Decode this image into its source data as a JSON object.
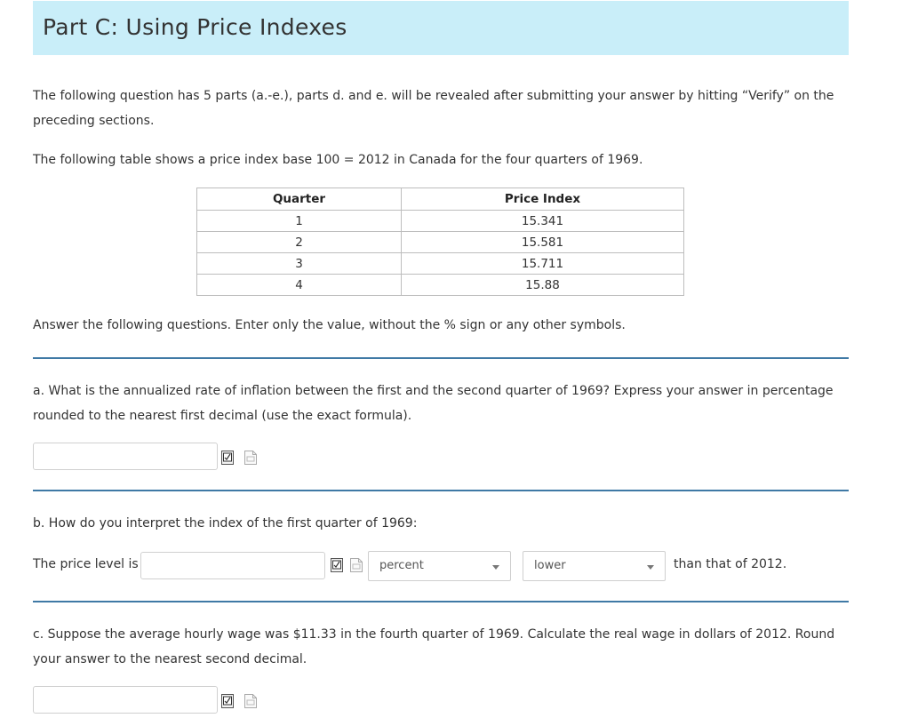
{
  "header": {
    "title": "Part C: Using Price Indexes"
  },
  "intro": {
    "line1": "The following question has 5 parts (a.-e.), parts d. and e. will be revealed after submitting your answer by hitting “Verify” on the preceding sections.",
    "table_caption": "The following table shows a price index base 100 = 2012 in Canada for the four quarters of 1969."
  },
  "price_table": {
    "headers": [
      "Quarter",
      "Price Index"
    ],
    "rows": [
      [
        "1",
        "15.341"
      ],
      [
        "2",
        "15.581"
      ],
      [
        "3",
        "15.711"
      ],
      [
        "4",
        "15.88"
      ]
    ]
  },
  "instructions": "Answer the following questions. Enter only the value, without the % sign or any other symbols.",
  "question_a": {
    "text": "a. What is the annualized rate of inflation between the first and the second quarter of 1969? Express your answer in percentage rounded to the nearest first decimal (use the exact formula).",
    "answer_value": ""
  },
  "question_b": {
    "text": "b. How do you interpret the index of the first quarter of 1969:",
    "prefix": "The price level is",
    "answer_value": "",
    "unit_select": "percent",
    "direction_select": "lower",
    "suffix": "than that of 2012."
  },
  "question_c": {
    "text": "c. Suppose the average hourly wage was $11.33 in the fourth quarter of 1969. Calculate the real wage in dollars of 2012. Round your answer to the nearest second decimal.",
    "answer_value": ""
  },
  "icons": {
    "formula_icon": "formula-editor-icon",
    "doc_icon": "document-icon"
  }
}
